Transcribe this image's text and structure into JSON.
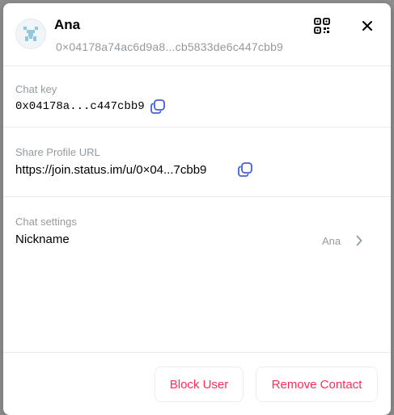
{
  "profile": {
    "name": "Ana",
    "short_key": "0×04178a74ac6d9a8...cb5833de6c447cbb9"
  },
  "chat_key": {
    "label": "Chat key",
    "value": "0x04178a...c447cbb9"
  },
  "share_url": {
    "label": "Share Profile URL",
    "value": "https://join.status.im/u/0×04...7cbb9"
  },
  "chat_settings": {
    "label": "Chat settings",
    "nickname_label": "Nickname",
    "nickname_value": "Ana"
  },
  "footer": {
    "block_label": "Block User",
    "remove_label": "Remove Contact"
  },
  "colors": {
    "accent": "#4360df",
    "danger": "#ff2d55",
    "muted": "#939ba1"
  },
  "icons": [
    "qr-code-icon",
    "close-icon",
    "copy-icon",
    "chevron-right-icon"
  ]
}
